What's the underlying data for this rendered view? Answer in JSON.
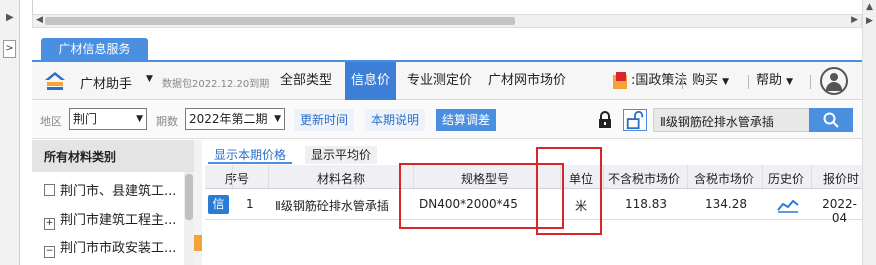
{
  "panel_tab": "广材信息服务",
  "toolbar": {
    "assistant": "广材助手",
    "package": "数据包2022.12.20到期",
    "nav": [
      "全部类型",
      "信息价",
      "专业测定价",
      "广材网市场价",
      "国政策法",
      "购买",
      "帮助"
    ],
    "active_nav": "信息价"
  },
  "filter": {
    "region_label": "地区",
    "region_value": "荆门",
    "period_label": "期数",
    "period_value": "2022年第二期",
    "buttons": [
      "更新时间",
      "本期说明",
      "结算调差"
    ],
    "search_value": "Ⅱ级钢筋砼排水管承插"
  },
  "categories": {
    "title": "所有材料类别",
    "items": [
      "荆门市、县建筑工...",
      "荆门市建筑工程主...",
      "荆门市市政安装工..."
    ]
  },
  "subtabs": [
    "显示本期价格",
    "显示平均价"
  ],
  "table": {
    "headers": [
      "序号",
      "材料名称",
      "规格型号",
      "单位",
      "不含税市场价",
      "含税市场价",
      "历史价",
      "报价时"
    ],
    "rows": [
      {
        "badge": "信",
        "index": "1",
        "name": "Ⅱ级钢筋砼排水管承插",
        "spec": "DN400*2000*45",
        "unit": "米",
        "price_ex_tax": "118.83",
        "price_inc_tax": "134.28",
        "date": "2022-04"
      }
    ]
  },
  "colors": {
    "accent": "#4a8fe0",
    "annotation": "#d9262b"
  }
}
